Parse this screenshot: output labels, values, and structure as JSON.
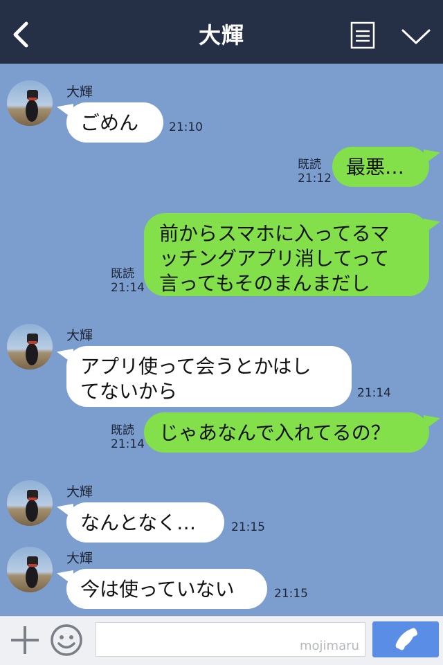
{
  "header": {
    "title": "大輝",
    "bg_color": "#252f45"
  },
  "chat": {
    "bg_color": "#7c9ecf",
    "messages": [
      {
        "side": "in",
        "sender": "大輝",
        "text": "ごめん",
        "time": "21:10"
      },
      {
        "side": "out",
        "read": "既読",
        "text": "最悪…",
        "time": "21:12"
      },
      {
        "side": "out",
        "read": "既読",
        "text": "前からスマホに入ってるマ\nッチングアプリ消してって\n言ってもそのまんまだし",
        "time": "21:14"
      },
      {
        "side": "in",
        "sender": "大輝",
        "text": "アプリ使って会うとかはし\nてないから",
        "time": "21:14"
      },
      {
        "side": "out",
        "read": "既読",
        "text": "じゃあなんで入れてるの？",
        "time": "21:14"
      },
      {
        "side": "in",
        "sender": "大輝",
        "text": "なんとなく…",
        "time": "21:15"
      },
      {
        "side": "in",
        "sender": "大輝",
        "text": "今は使っていない",
        "time": "21:15"
      }
    ]
  },
  "footer": {
    "input_value": "",
    "watermark": "mojimaru",
    "send_color": "#5a8ee6"
  },
  "icons": [
    "back-icon",
    "menu-icon",
    "chevron-down-icon",
    "plus-icon",
    "emoji-icon",
    "phone-icon"
  ]
}
